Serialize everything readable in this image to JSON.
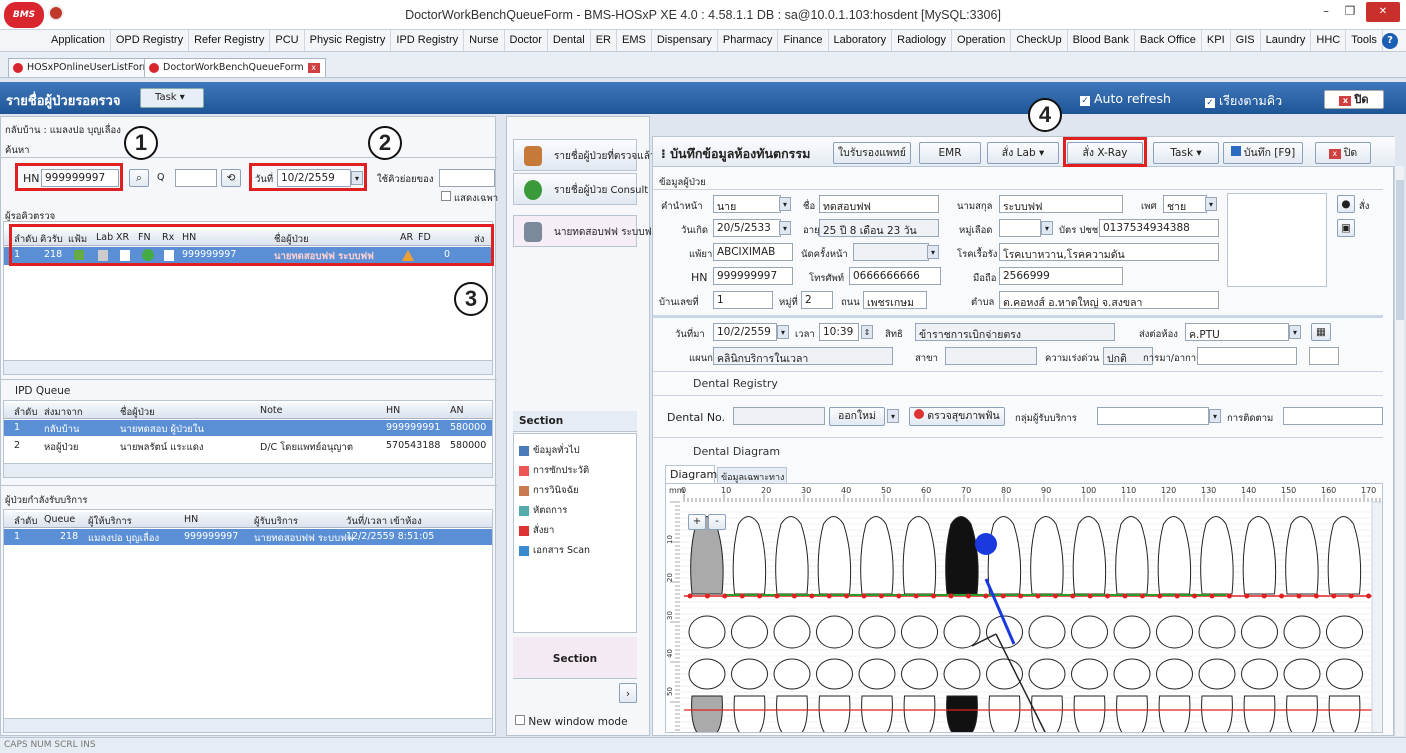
{
  "window": {
    "title": "DoctorWorkBenchQueueForm - BMS-HOSxP XE 4.0 : 4.58.1.1 DB : sa@10.0.1.103:hosdent [MySQL:3306]",
    "logo": "BMS"
  },
  "menu": [
    "Application",
    "OPD Registry",
    "Refer Registry",
    "PCU",
    "Physic Registry",
    "IPD Registry",
    "Nurse",
    "Doctor",
    "Dental",
    "ER",
    "EMS",
    "Dispensary",
    "Pharmacy",
    "Finance",
    "Laboratory",
    "Radiology",
    "Operation",
    "CheckUp",
    "Blood Bank",
    "Back Office",
    "KPI",
    "GIS",
    "Laundry",
    "HHC",
    "Tools"
  ],
  "doc_tabs": [
    "HOSxPOnlineUserListForm",
    "DoctorWorkBenchQueueForm"
  ],
  "form": {
    "title": "รายชื่อผู้ป่วยรอตรวจ",
    "task": "Task",
    "auto_refresh": "Auto refresh",
    "queue_order": "เรียงตามคิว",
    "close": "ปิด"
  },
  "left": {
    "status_line": "กลับบ้าน : แมลงปอ บุญเลื่อง",
    "search_title": "ค้นหา",
    "hn_label": "HN",
    "hn_value": "999999997",
    "q_label": "Q",
    "date_label": "วันที่",
    "date_value": "10/2/2559",
    "queue_label": "ใช้คิวย่อยของ",
    "show_label": "แสดงเฉพา",
    "waiting_title": "ผู้รอคิวตรวจ",
    "waiting_cols": [
      "ลำดับ",
      "คิวรับ",
      "แฟ้ม",
      "Lab",
      "XR",
      "FN",
      "Rx",
      "HN",
      "ชื่อผู้ป่วย",
      "AR",
      "FD",
      "ส่ง"
    ],
    "waiting_row": {
      "no": "1",
      "queue": "218",
      "hn": "999999997",
      "name": "นายทดสอบฟฟ ระบบฟฟ",
      "fd": "0"
    },
    "ipd_title": "IPD Queue",
    "ipd_cols": [
      "ลำดับ",
      "ส่งมาจาก",
      "ชื่อผู้ป่วย",
      "Note",
      "HN",
      "AN"
    ],
    "ipd_rows": [
      {
        "no": "1",
        "from": "กลับบ้าน",
        "name": "นายทดสอบ ผู้ป่วยใน",
        "note": "",
        "hn": "999999991",
        "an": "580000"
      },
      {
        "no": "2",
        "from": "หอผู้ป่วย",
        "name": "นายพลรัตน์ แระแดง",
        "note": "D/C โดยแพทย์อนุญาต",
        "hn": "570543188",
        "an": "580000"
      }
    ],
    "svc_title": "ผู้ป่วยกำลังรับบริการ",
    "svc_cols": [
      "ลำดับ",
      "Queue",
      "ผู้ให้บริการ",
      "HN",
      "ผู้รับบริการ",
      "วันที่/เวลา เข้าห้อง"
    ],
    "svc_row": {
      "no": "1",
      "queue": "218",
      "provider": "แมลงปอ บุญเลื่อง",
      "hn": "999999997",
      "patient": "นายทดสอบฟฟ ระบบฟฟ",
      "time": "12/2/2559 8:51:05"
    }
  },
  "side": {
    "items": [
      "รายชื่อผู้ป่วยที่ตรวจแล้ว",
      "รายชื่อผู้ป่วย Consult",
      "นายทดสอบฟฟ ระบบฟฟ"
    ],
    "section_title": "Section",
    "sections": [
      "ข้อมูลทั่วไป",
      "การซักประวัติ",
      "การวินิจฉัย",
      "หัตถการ",
      "สั่งยา",
      "เอกสาร Scan"
    ],
    "section_bottom": "Section",
    "new_window": "New window mode"
  },
  "main": {
    "title": "บันทึกข้อมูลห้องทันตกรรม",
    "buttons": {
      "cert": "ใบรับรองแพทย์",
      "emr": "EMR",
      "lab": "สั่ง Lab",
      "xray": "สั่ง X-Ray",
      "task": "Task",
      "save": "บันทึก [F9]",
      "close": "ปิด"
    },
    "patient_title": "ข้อมูลผู้ป่วย",
    "prefix_label": "คำนำหน้า",
    "prefix": "นาย",
    "fname_label": "ชื่อ",
    "fname": "ทดสอบฟฟ",
    "lname_label": "นามสกุล",
    "lname": "ระบบฟฟ",
    "sex_label": "เพศ",
    "sex": "ชาย",
    "side_label": "สั่ง",
    "dob_label": "วันเกิด",
    "dob": "20/5/2533",
    "age_label": "อายุ",
    "age": "25 ปี 8 เดือน 23 วัน",
    "blood_label": "หมู่เลือด",
    "cid_label": "บัตร ปชช.",
    "cid": "0137534934388",
    "allergy_label": "แพ้ยา",
    "allergy": "ABCIXIMAB",
    "appoint_label": "นัดครั้งหน้า",
    "chronic_label": "โรคเรื้อรัง",
    "chronic": "โรคเบาหวาน,โรคความดัน",
    "hn_label": "HN",
    "hn": "999999997",
    "phone_label": "โทรศัพท์",
    "phone": "0666666666",
    "mobile_label": "มือถือ",
    "mobile": "2566999",
    "house_label": "บ้านเลขที่",
    "house": "1",
    "moo_label": "หมู่ที่",
    "moo": "2",
    "road_label": "ถนน",
    "road": "เพชรเกษม",
    "tambon_label": "ตำบล",
    "tambon": "ต.คอหงส์ อ.หาดใหญ่ จ.สงขลา",
    "visit_label": "วันที่มา",
    "visit_date": "10/2/2559",
    "time_label": "เวลา",
    "time": "10:39",
    "right_label": "สิทธิ",
    "right": "ข้าราชการเบิกจ่ายตรง",
    "sendto_label": "ส่งต่อห้อง",
    "sendto": "ค.PTU",
    "dept_label": "แผนก",
    "dept": "คลินิกบริการในเวลา",
    "branch_label": "สาขา",
    "urgency_label": "ความเร่งด่วน",
    "urgency": "ปกติ",
    "cc_label": "การมา/อาการ",
    "dental_reg_title": "Dental Registry",
    "dental_no_label": "Dental No.",
    "new_btn": "ออกใหม่",
    "check_btn": "ตรวจสุขภาพฟัน",
    "group_label": "กลุ่มผู้รับบริการ",
    "follow_label": "การติดตาม",
    "diagram_title": "Dental Diagram",
    "tabs": [
      "Diagram",
      "ข้อมูลเฉพาะทาง"
    ],
    "ruler_unit": "mm",
    "ruler_ticks": [
      "0",
      "10",
      "20",
      "30",
      "40",
      "50",
      "60",
      "70",
      "80",
      "90",
      "100",
      "110",
      "120",
      "130",
      "140",
      "150",
      "160",
      "170"
    ],
    "left_ticks": [
      "10",
      "20",
      "30",
      "40",
      "50"
    ],
    "zoom_in": "+",
    "zoom_out": "-"
  },
  "callouts": [
    "1",
    "2",
    "3",
    "4"
  ],
  "status": "CAPS  NUM  SCRL  INS"
}
